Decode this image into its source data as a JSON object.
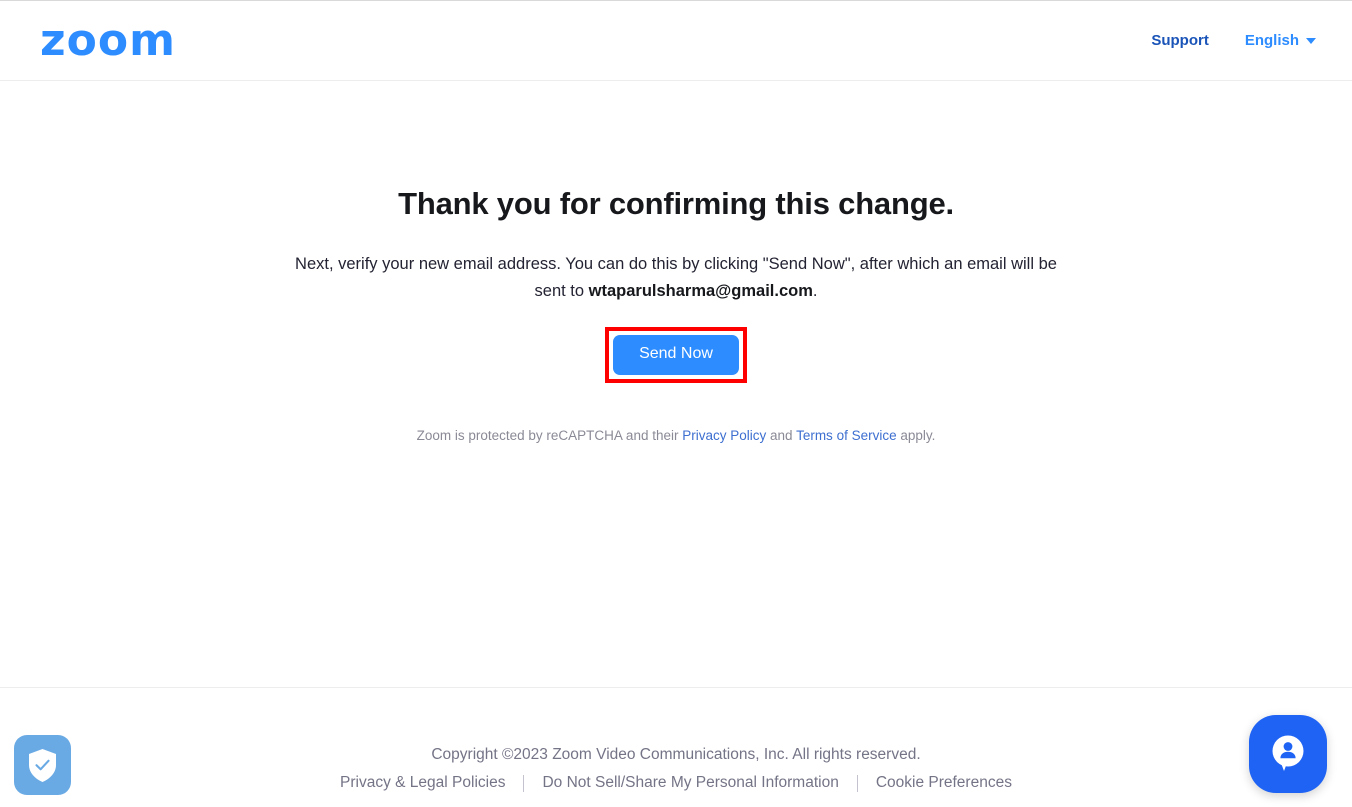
{
  "header": {
    "logo_text": "zoom",
    "logo_icon": "zoom-logo",
    "support_label": "Support",
    "language_label": "English",
    "caret_icon": "chevron-down-icon",
    "accent_color": "#2d8cff",
    "support_color": "#1a54b8"
  },
  "main": {
    "heading": "Thank you for confirming this change.",
    "body_before_email": "Next, verify your new email address. You can do this by clicking \"Send Now\", after which an email will be sent to ",
    "email": "wtaparulsharma@gmail.com",
    "body_after_email": ".",
    "send_button_label": "Send Now",
    "annotation_color": "#fe0000"
  },
  "recaptcha": {
    "text_before": "Zoom is protected by reCAPTCHA and their ",
    "privacy_policy_label": "Privacy Policy",
    "text_middle": " and ",
    "terms_label": "Terms of Service",
    "text_after": " apply.",
    "link_color": "#3d6fd0"
  },
  "footer": {
    "copyright": "Copyright ©2023 Zoom Video Communications, Inc. All rights reserved.",
    "links": [
      {
        "label": "Privacy & Legal Policies"
      },
      {
        "label": "Do Not Sell/Share My Personal Information"
      },
      {
        "label": "Cookie Preferences"
      }
    ],
    "text_color": "#747487"
  },
  "widgets": {
    "shield_icon": "shield-check-icon",
    "chat_icon": "support-chat-person-icon",
    "shield_color": "#6aaae4",
    "chat_color": "#1f63f5"
  }
}
